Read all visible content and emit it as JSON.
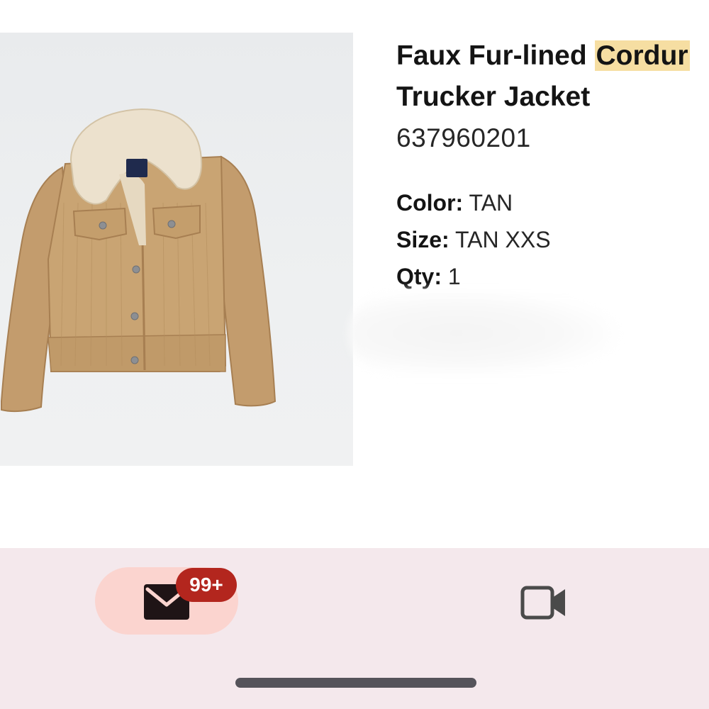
{
  "product": {
    "title_line1_prefix": "Faux Fur-lined ",
    "title_line1_highlight": "Cordur",
    "title_line2": "Trucker Jacket",
    "sku": "637960201",
    "image_icon": "tan-corduroy-jacket-image",
    "attributes": [
      {
        "label": "Color:",
        "value": " TAN"
      },
      {
        "label": "Size:",
        "value": " TAN XXS"
      },
      {
        "label": "Qty:",
        "value": " 1"
      }
    ]
  },
  "bottom_nav": {
    "mail_icon": "mail-icon",
    "mail_badge": "99+",
    "video_icon": "video-camera-icon"
  },
  "colors": {
    "highlight": "#f6dea2",
    "nav_background": "#f4e8ec",
    "nav_pill": "#fbd4cf",
    "badge": "#b3261e"
  }
}
